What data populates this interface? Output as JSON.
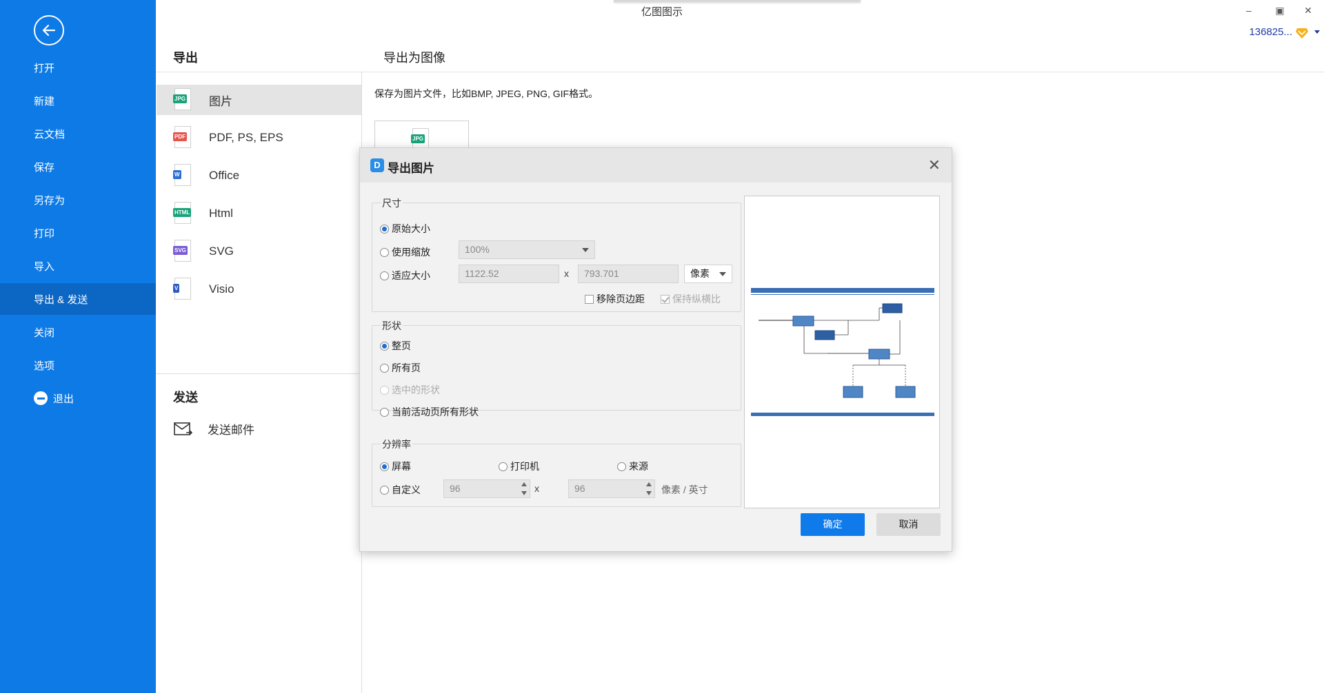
{
  "app": {
    "title": "亿图图示",
    "user_id": "136825...",
    "window_controls": [
      "minimize-icon",
      "restore-icon",
      "close-icon"
    ]
  },
  "sidebar": {
    "back_icon": "back-arrow-icon",
    "items": [
      {
        "label": "打开"
      },
      {
        "label": "新建"
      },
      {
        "label": "云文档"
      },
      {
        "label": "保存"
      },
      {
        "label": "另存为"
      },
      {
        "label": "打印"
      },
      {
        "label": "导入"
      },
      {
        "label": "导出 & 发送",
        "active": true
      },
      {
        "label": "关闭"
      },
      {
        "label": "选项"
      },
      {
        "label": "退出",
        "icon": "exit-icon"
      }
    ]
  },
  "export": {
    "title": "导出",
    "items": [
      {
        "label": "图片",
        "tag": "JPG",
        "color": "#1aa37a",
        "active": true
      },
      {
        "label": "PDF, PS, EPS",
        "tag": "PDF",
        "color": "#e8534a"
      },
      {
        "label": "Office",
        "tag": "W",
        "color": "#2d6fd6"
      },
      {
        "label": "Html",
        "tag": "HTML",
        "color": "#1aa37a"
      },
      {
        "label": "SVG",
        "tag": "SVG",
        "color": "#7a5bd6"
      },
      {
        "label": "Visio",
        "tag": "V",
        "color": "#2d5bc2"
      }
    ],
    "send_title": "发送",
    "send_mail_label": "发送邮件",
    "right_title": "导出为图像",
    "description": "保存为图片文件，比如BMP, JPEG, PNG, GIF格式。",
    "thumb_tag": "JPG"
  },
  "dialog": {
    "title": "导出图片",
    "size_group": {
      "label": "尺寸",
      "original": "原始大小",
      "use_scale": "使用缩放",
      "scale_value": "100%",
      "fit_size": "适应大小",
      "width": "1122.52",
      "height": "793.701",
      "unit": "像素",
      "remove_margin": "移除页边距",
      "keep_ratio": "保持纵横比",
      "x": "x"
    },
    "shape_group": {
      "label": "形状",
      "whole_page": "整页",
      "all_pages": "所有页",
      "selected_shapes": "选中的形状",
      "current_page_shapes": "当前活动页所有形状"
    },
    "resolution_group": {
      "label": "分辨率",
      "screen": "屏幕",
      "printer": "打印机",
      "source": "来源",
      "custom": "自定义",
      "dpi_x": "96",
      "dpi_y": "96",
      "unit": "像素 / 英寸",
      "x": "x"
    },
    "ok": "确定",
    "cancel": "取消"
  },
  "colors": {
    "sidebar_bg": "#0e7ae6",
    "sidebar_active": "#0b66c4",
    "primary_button": "#0f7bea"
  }
}
